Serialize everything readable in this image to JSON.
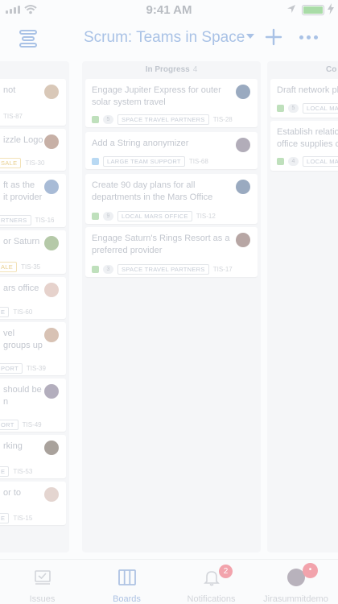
{
  "status_bar": {
    "time": "9:41 AM"
  },
  "header": {
    "title": "Scrum: Teams in Space"
  },
  "columns": {
    "left": {
      "cards": [
        {
          "line1": "not",
          "key": "TIS-87"
        },
        {
          "line1": "izzle Logo",
          "epic": "SALE",
          "key": "TIS-30"
        },
        {
          "line1": "ft as the",
          "line2": "it provider",
          "epic": "RTNERS",
          "key": "TIS-16"
        },
        {
          "line1": "or Saturn",
          "epic": "ALE",
          "key": "TIS-35"
        },
        {
          "line1": "ars office",
          "epic": "E",
          "key": "TIS-60"
        },
        {
          "line1": "vel",
          "line2": "groups up",
          "epic": "PORT",
          "key": "TIS-39"
        },
        {
          "line1": "should be",
          "line2": "n",
          "epic": "ORT",
          "key": "TIS-49"
        },
        {
          "line1": "rking",
          "epic": "E",
          "key": "TIS-53"
        },
        {
          "line1": "or to",
          "epic": "E",
          "key": "TIS-15"
        }
      ]
    },
    "middle": {
      "title": "In Progress",
      "count": "4",
      "cards": [
        {
          "summary_1": "Engage Jupiter Express for outer",
          "summary_2": "solar system travel",
          "points": "5",
          "epic": "SPACE TRAVEL PARTNERS",
          "key": "TIS-28"
        },
        {
          "summary_1": "Add a String anonymizer",
          "summary_2": "",
          "epic": "LARGE TEAM SUPPORT",
          "key": "TIS-68"
        },
        {
          "summary_1": "Create 90 day plans for all",
          "summary_2": "departments in the Mars Office",
          "points": "9",
          "epic": "LOCAL MARS OFFICE",
          "key": "TIS-12"
        },
        {
          "summary_1": "Engage Saturn's Rings Resort as a",
          "summary_2": "preferred provider",
          "points": "3",
          "epic": "SPACE TRAVEL PARTNERS",
          "key": "TIS-17"
        }
      ]
    },
    "right": {
      "title": "Co",
      "cards": [
        {
          "summary_1": "Draft network pla",
          "points": "5",
          "epic": "LOCAL MA"
        },
        {
          "summary_1": "Establish relation",
          "summary_2": "office supplies co",
          "points": "4",
          "epic": "LOCAL MA"
        }
      ]
    }
  },
  "tabs": [
    {
      "label": "Issues"
    },
    {
      "label": "Boards"
    },
    {
      "label": "Notifications",
      "badge": "2"
    },
    {
      "label": "Jirasummitdemo"
    }
  ],
  "colors": {
    "accent": "#aec3e3",
    "badge": "#f2a3ac",
    "story": "#bfe0bc",
    "task": "#b9d9f3"
  }
}
